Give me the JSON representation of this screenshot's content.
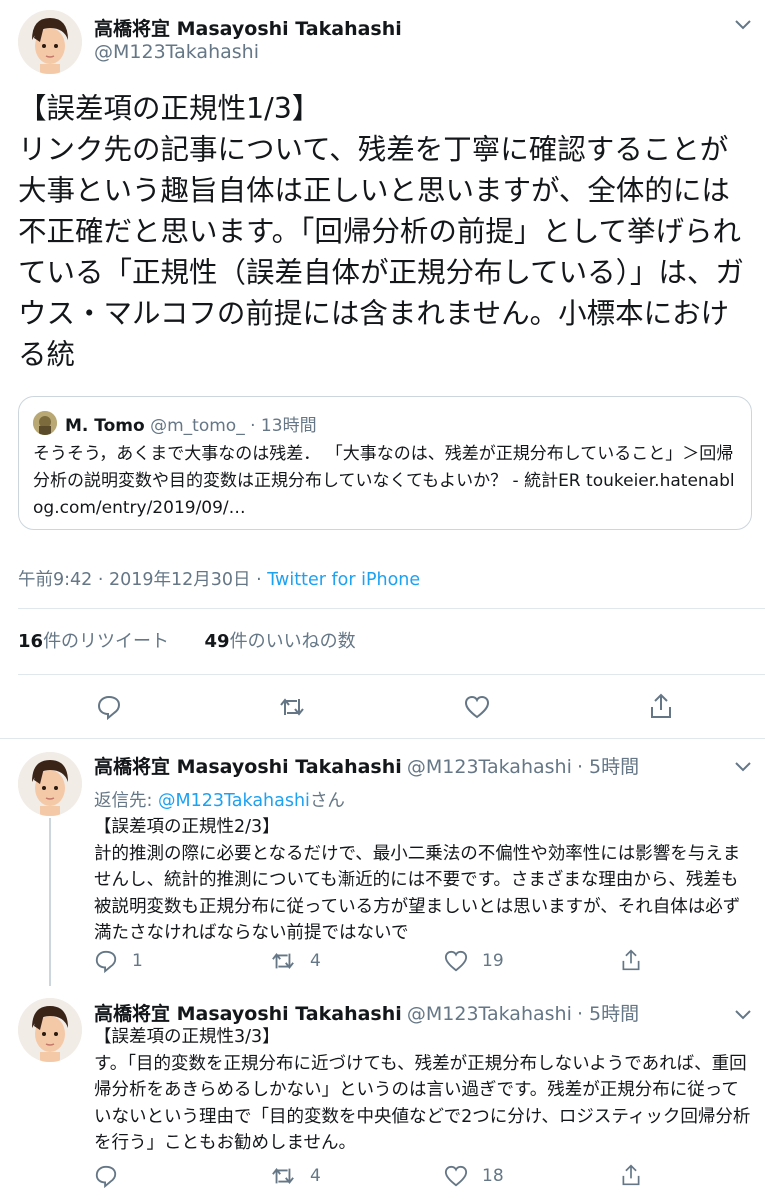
{
  "main_tweet": {
    "display_name": "高橋将宜 Masayoshi Takahashi",
    "handle": "@M123Takahashi",
    "text": "【誤差項の正規性1/3】\nリンク先の記事について、残差を丁寧に確認することが大事という趣旨自体は正しいと思いますが、全体的には不正確だと思います。「回帰分析の前提」として挙げられている「正規性（誤差自体が正規分布している）」は、ガウス・マルコフの前提には含まれません。小標本における統",
    "quoted": {
      "display_name": "M. Tomo",
      "handle": "@m_tomo_",
      "time": "· 13時間",
      "text": "そうそう，あくまで大事なのは残差． 「大事なのは、残差が正規分布していること」＞回帰分析の説明変数や目的変数は正規分布していなくてもよいか？ - 統計ER ",
      "link": "toukeier.hatenablog.com/entry/2019/09/…"
    },
    "timestamp": "午前9:42 · 2019年12月30日 · ",
    "source": "Twitter for iPhone",
    "retweets_count": "16",
    "retweets_label": "件のリツイート",
    "likes_count": "49",
    "likes_label": "件のいいねの数"
  },
  "replies": [
    {
      "display_name": "高橋将宜 Masayoshi Takahashi",
      "handle": "@M123Takahashi",
      "time": "· 5時間",
      "reply_to_prefix": "返信先: ",
      "reply_to_mention": "@M123Takahashi",
      "reply_to_suffix": "さん",
      "text": "【誤差項の正規性2/3】\n計的推測の際に必要となるだけで、最小二乗法の不偏性や効率性には影響を与えませんし、統計的推測についても漸近的には不要です。さまざまな理由から、残差も被説明変数も正規分布に従っている方が望ましいとは思いますが、それ自体は必ず満たさなければならない前提ではないで",
      "reply_count": "1",
      "retweet_count": "4",
      "like_count": "19"
    },
    {
      "display_name": "高橋将宜 Masayoshi Takahashi",
      "handle": "@M123Takahashi",
      "time": "· 5時間",
      "text": "【誤差項の正規性3/3】\nす。「目的変数を正規分布に近づけても、残差が正規分布しないようであれば、重回帰分析をあきらめるしかない」というのは言い過ぎです。残差が正規分布に従っていないという理由で「目的変数を中央値などで2つに分け、ロジスティック回帰分析を行う」こともお勧めしません。",
      "reply_count": "",
      "retweet_count": "4",
      "like_count": "18"
    }
  ],
  "icons": [
    "chevron-down-icon",
    "reply-icon",
    "retweet-icon",
    "like-icon",
    "share-icon"
  ],
  "colors": {
    "link": "#1da1f2",
    "secondary_text": "#657786",
    "divider": "#e1e8ed"
  }
}
